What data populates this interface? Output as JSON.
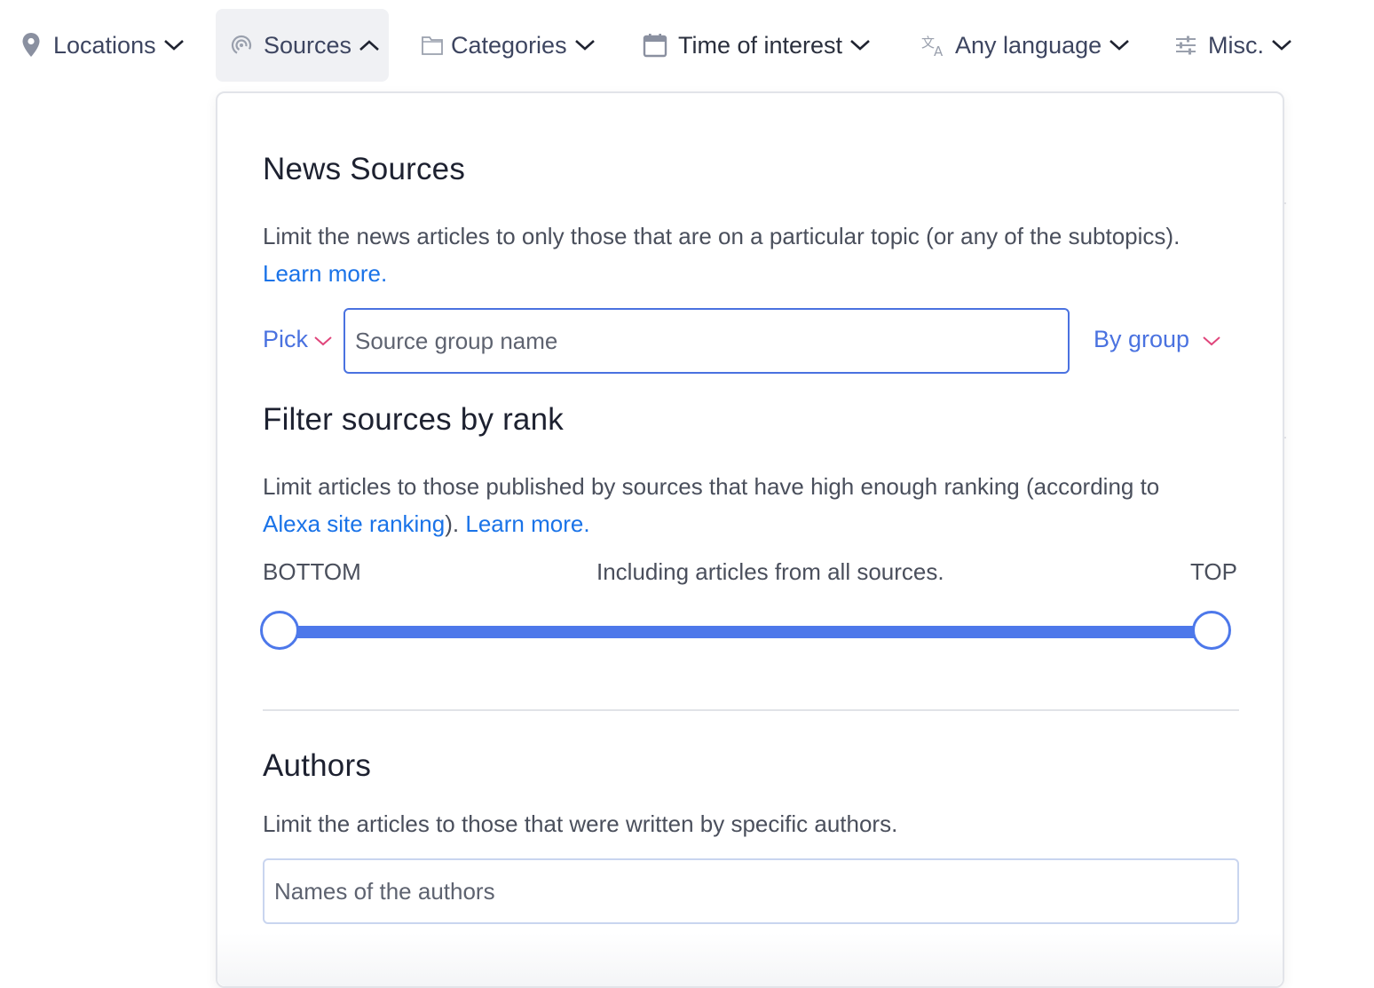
{
  "filter_bar": {
    "items": [
      {
        "label": "Locations",
        "icon": "map-pin-icon"
      },
      {
        "label": "Sources",
        "icon": "broadcast-icon",
        "active": true
      },
      {
        "label": "Categories",
        "icon": "folder-icon"
      },
      {
        "label": "Time of interest",
        "icon": "calendar-icon"
      },
      {
        "label": "Any language",
        "icon": "translate-icon"
      },
      {
        "label": "Misc.",
        "icon": "sliders-icon"
      }
    ]
  },
  "panel": {
    "news_sources": {
      "title": "News Sources",
      "description": "Limit the news articles to only those that are on a particular topic (or any of the subtopics).",
      "learn_more": "Learn more.",
      "pick_label": "Pick",
      "input_placeholder": "Source group name",
      "input_value": "",
      "group_mode": "By group"
    },
    "rank_filter": {
      "title": "Filter sources by rank",
      "description_prefix": "Limit articles to those published by sources that have high enough ranking (according to",
      "alexa_link": "Alexa site ranking",
      "description_suffix": ").",
      "learn_more": "Learn more.",
      "min_label": "BOTTOM",
      "max_label": "TOP",
      "status": "Including articles from all sources.",
      "range": {
        "min": 0,
        "max": 1
      }
    },
    "authors": {
      "title": "Authors",
      "description": "Limit the articles to those that were written by specific authors.",
      "input_placeholder": "Names of the authors",
      "input_value": ""
    }
  },
  "colors": {
    "accent": "#4a72e0",
    "link": "#1a73e8",
    "dropdown_chevron": "#e0457b",
    "slider": "#4d78ea"
  }
}
